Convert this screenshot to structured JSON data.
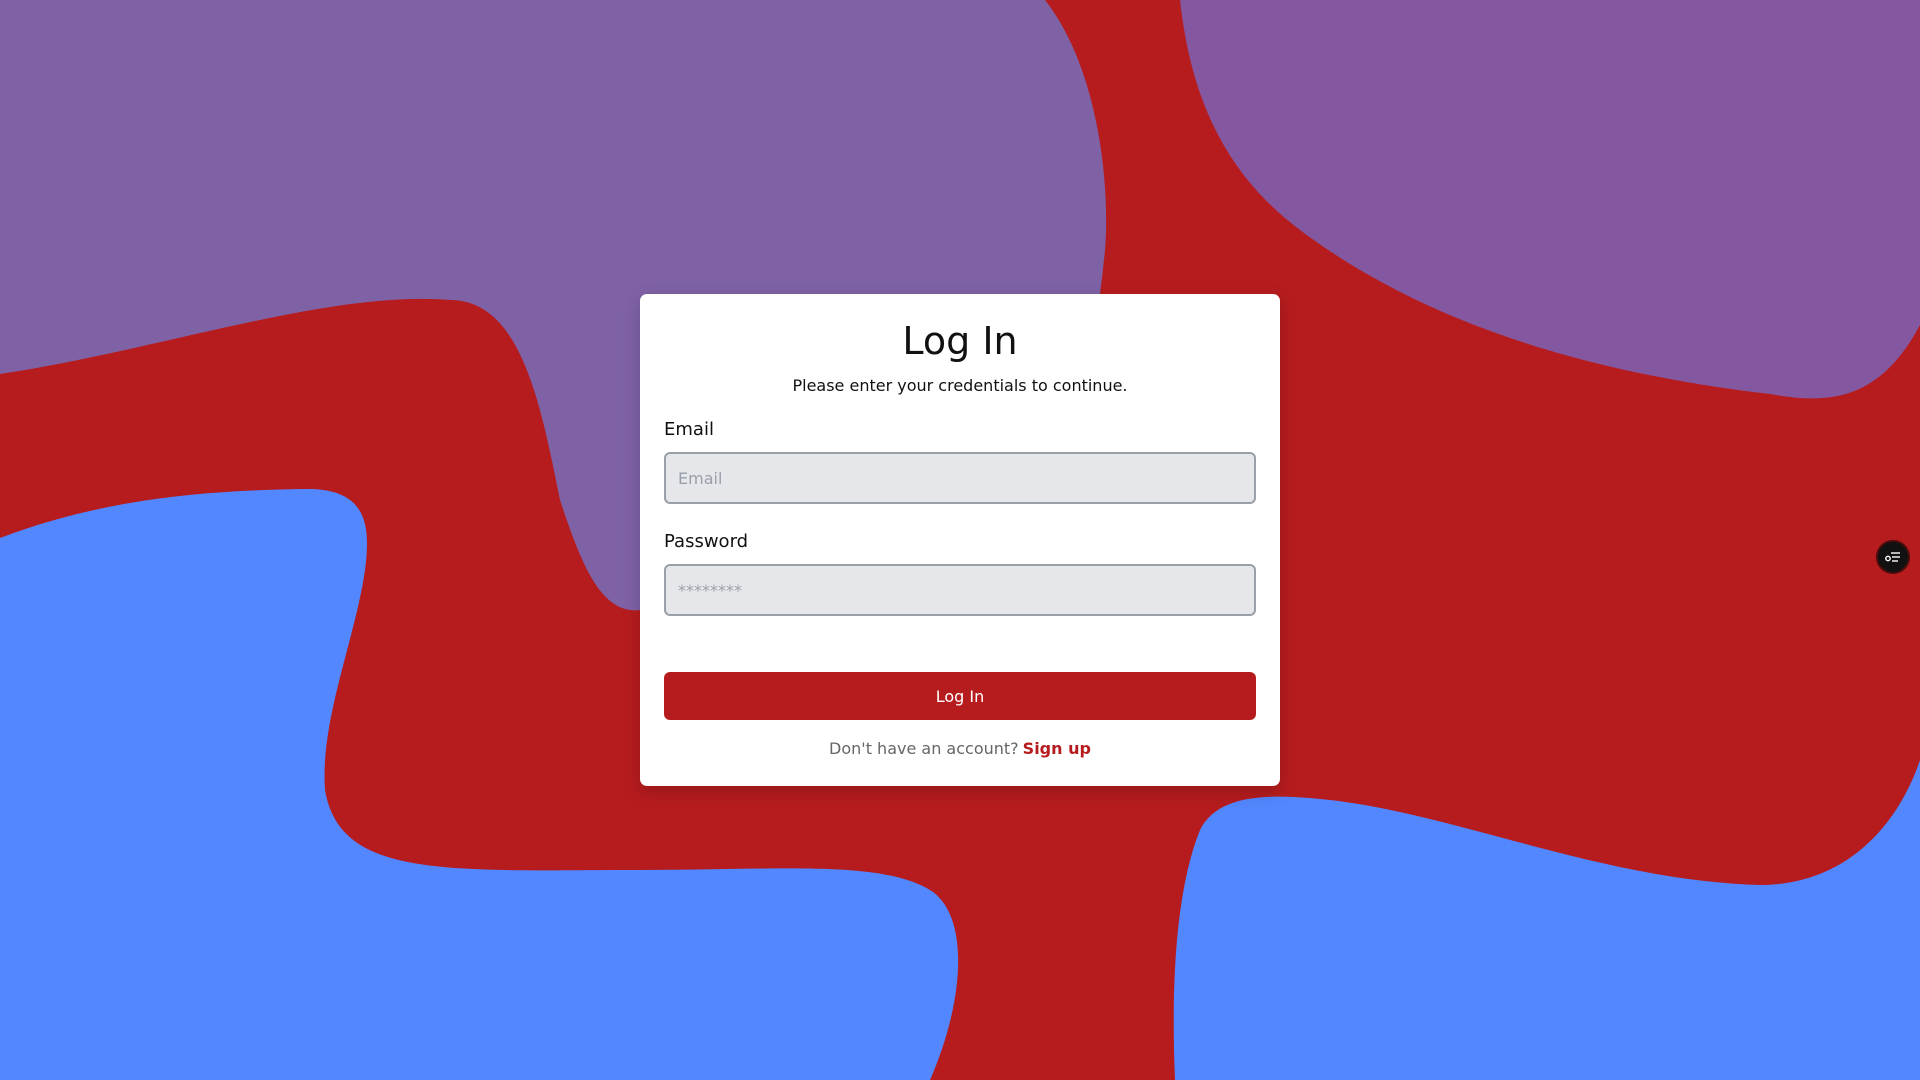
{
  "background": {
    "base_color": "#b61c1e",
    "blob_colors": [
      "#7f62a6",
      "#8458a0",
      "#5387ff"
    ]
  },
  "login": {
    "title": "Log In",
    "subtitle": "Please enter your credentials to continue.",
    "email": {
      "label": "Email",
      "placeholder": "Email",
      "value": ""
    },
    "password": {
      "label": "Password",
      "placeholder": "********",
      "value": ""
    },
    "submit_label": "Log In",
    "signup_prompt": "Don't have an account?",
    "signup_link": "Sign up"
  },
  "floating_button": {
    "icon": "settings-list-icon"
  },
  "colors": {
    "accent": "#b61c1e",
    "card_background": "#ffffff",
    "input_background": "#e5e7eb"
  }
}
